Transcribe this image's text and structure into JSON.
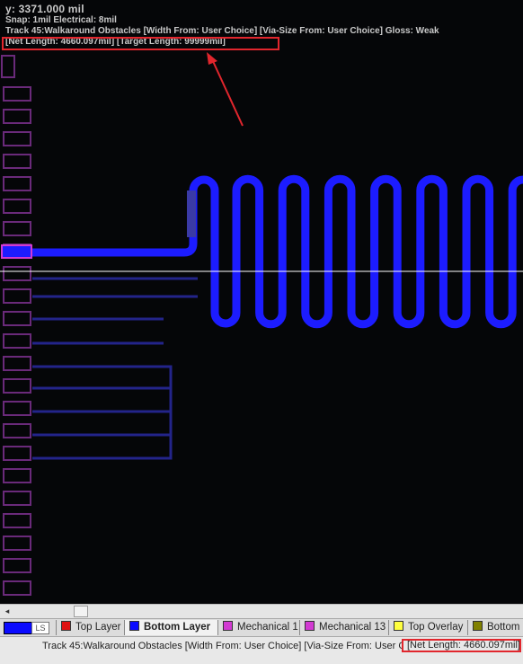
{
  "hud": {
    "y_readout": "y:  3371.000  mil",
    "snap": "Snap: 1mil Electrical: 8mil",
    "track": "Track 45:Walkaround Obstacles [Width From: User Choice] [Via-Size From: User Choice] Gloss: Weak",
    "lengths": "[Net Length: 4660.097mil] [Target Length:  99999mil]"
  },
  "colors": {
    "background": "#050608",
    "trace_blue": "#1c1cff",
    "dim_trace": "#23248a",
    "pad_magenta": "#6a2a7a",
    "highlight": "#e1262d"
  },
  "tabs": {
    "current_layer_icon": "LS",
    "items": [
      {
        "label": "Top Layer",
        "color": "#e01010"
      },
      {
        "label": "Bottom Layer",
        "color": "#0a0aff"
      },
      {
        "label": "Mechanical 1",
        "color": "#d23ad2"
      },
      {
        "label": "Mechanical 13",
        "color": "#d23ad2"
      },
      {
        "label": "Top Overlay",
        "color": "#ffff40"
      },
      {
        "label": "Bottom O",
        "color": "#808000"
      }
    ]
  },
  "status": {
    "text": "Track 45:Walkaround Obstacles [Width From: User Choice] [Via-Size From: User C",
    "net_length": "[Net Length: 4660.097mil]"
  },
  "scroll": {
    "left_arrow": "◂"
  }
}
